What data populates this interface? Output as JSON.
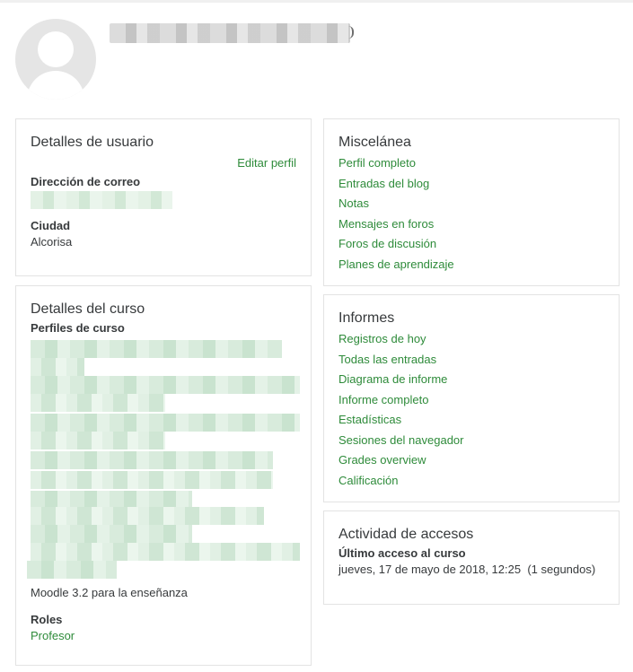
{
  "user_details": {
    "title": "Detalles de usuario",
    "edit_link": "Editar perfil",
    "email_label": "Dirección de correo",
    "city_label": "Ciudad",
    "city_value": "Alcorisa"
  },
  "course_details": {
    "title": "Detalles del curso",
    "profiles_label": "Perfiles de curso",
    "last_course": "Moodle 3.2 para la enseñanza",
    "roles_label": "Roles",
    "role_value": "Profesor"
  },
  "misc": {
    "title": "Miscelánea",
    "links": [
      "Perfil completo",
      "Entradas del blog",
      "Notas",
      "Mensajes en foros",
      "Foros de discusión",
      "Planes de aprendizaje"
    ]
  },
  "reports": {
    "title": "Informes",
    "links": [
      "Registros de hoy",
      "Todas las entradas",
      "Diagrama de informe",
      "Informe completo",
      "Estadísticas",
      "Sesiones del navegador",
      "Grades overview",
      "Calificación"
    ]
  },
  "access": {
    "title": "Actividad de accesos",
    "last_access_label": "Último acceso al curso",
    "last_access_value": "jueves, 17 de mayo de 2018, 12:25  (1 segundos)"
  },
  "colors": {
    "link": "#2e8b3a",
    "border": "#e3e3e3"
  },
  "icons": {
    "avatar": "user-silhouette-icon"
  }
}
